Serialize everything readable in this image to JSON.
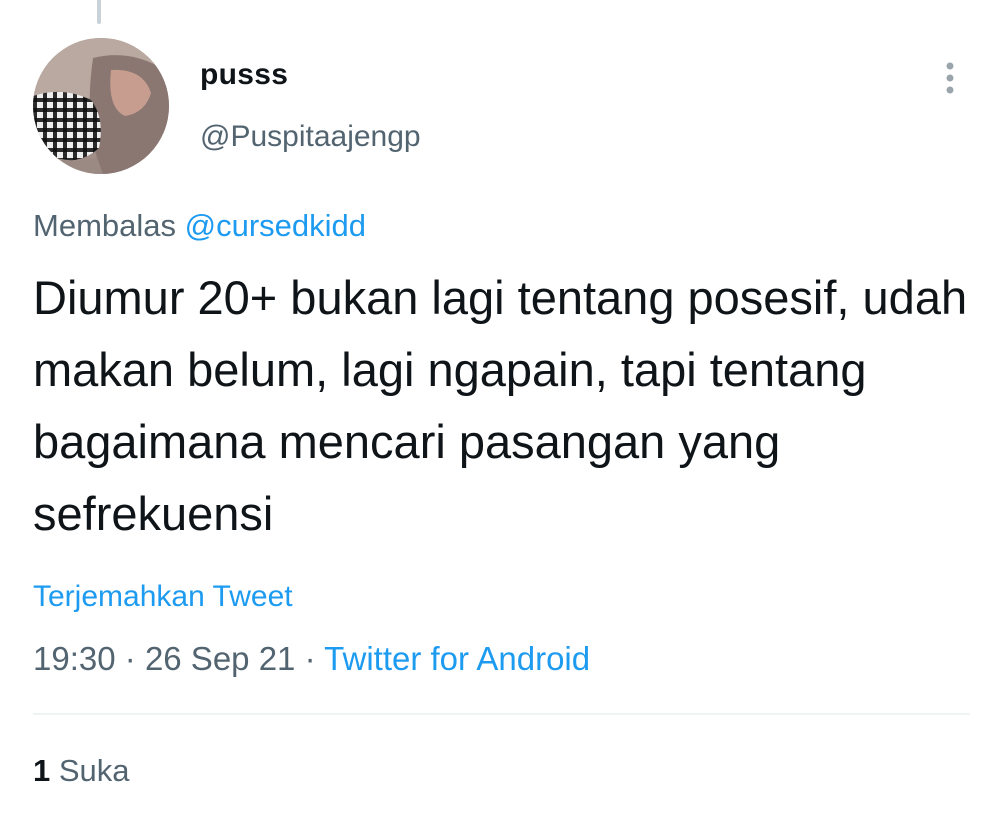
{
  "tweet": {
    "display_name": "pusss",
    "handle": "@Puspitaajengp",
    "reply_prefix": "Membalas",
    "reply_to": "@cursedkidd",
    "text": "Diumur 20+ bukan lagi tentang posesif, udah makan belum, lagi ngapain, tapi tentang bagaimana mencari pasangan yang sefrekuensi",
    "translate_label": "Terjemahkan Tweet",
    "time": "19:30",
    "date": "26 Sep 21",
    "source": "Twitter for Android",
    "separator": "·",
    "like_count": "1",
    "like_label": "Suka"
  },
  "icons": {
    "more": "more-vertical-icon",
    "avatar": "avatar-photo"
  },
  "colors": {
    "link": "#1d9bf0",
    "secondary_text": "#536471",
    "primary_text": "#0f1419",
    "divider": "#eff3f4"
  }
}
